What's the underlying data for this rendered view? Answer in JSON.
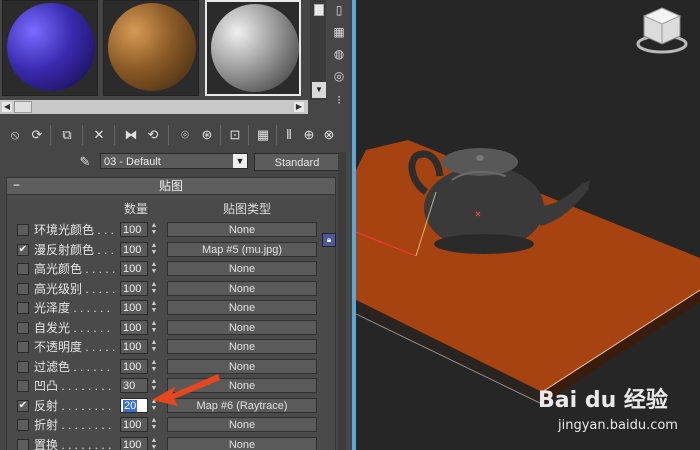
{
  "sample_slots": [
    {
      "name": "purple-glossy",
      "colors": [
        "#7a6cff",
        "#3a2ab0",
        "#120a40"
      ],
      "selected": false
    },
    {
      "name": "wood",
      "colors": [
        "#d79a55",
        "#8a5a26",
        "#3a2410"
      ],
      "selected": false
    },
    {
      "name": "default-gray",
      "colors": [
        "#f0f0f0",
        "#9a9a9a",
        "#2e2e2e"
      ],
      "selected": true
    }
  ],
  "material": {
    "name": "03 - Default",
    "type_button": "Standard"
  },
  "maps_rollout": {
    "title": "贴图",
    "col_amount": "数量",
    "col_maptype": "贴图类型",
    "rows": [
      {
        "label": "环境光颜色 . . .",
        "checked": false,
        "amount": "100",
        "map": "None",
        "active": false
      },
      {
        "label": "漫反射颜色 . . .",
        "checked": true,
        "amount": "100",
        "map": "Map #5 (mu.jpg)",
        "active": false
      },
      {
        "label": "高光颜色 . . . . .",
        "checked": false,
        "amount": "100",
        "map": "None",
        "active": false
      },
      {
        "label": "高光级别 . . . . .",
        "checked": false,
        "amount": "100",
        "map": "None",
        "active": false
      },
      {
        "label": "光泽度 . . . . . .",
        "checked": false,
        "amount": "100",
        "map": "None",
        "active": false
      },
      {
        "label": "自发光 . . . . . .",
        "checked": false,
        "amount": "100",
        "map": "None",
        "active": false
      },
      {
        "label": "不透明度 . . . . .",
        "checked": false,
        "amount": "100",
        "map": "None",
        "active": false
      },
      {
        "label": "过滤色 . . . . . .",
        "checked": false,
        "amount": "100",
        "map": "None",
        "active": false
      },
      {
        "label": "凹凸 . . . . . . . .",
        "checked": false,
        "amount": "30",
        "map": "None",
        "active": false
      },
      {
        "label": "反射 . . . . . . . .",
        "checked": true,
        "amount": "20",
        "map": "Map #6 (Raytrace)",
        "active": true
      },
      {
        "label": "折射 . . . . . . . .",
        "checked": false,
        "amount": "100",
        "map": "None",
        "active": false
      },
      {
        "label": "置换 . . . . . . . .",
        "checked": false,
        "amount": "100",
        "map": "None",
        "active": false
      }
    ]
  },
  "annotation_color": "#e8461e",
  "viewport": {
    "background": "#262626",
    "plane_color": "#a64310",
    "teapot_color": "#3a3a3a"
  },
  "watermark": {
    "logo_text": "Bai du 经验",
    "url": "jingyan.baidu.com"
  }
}
